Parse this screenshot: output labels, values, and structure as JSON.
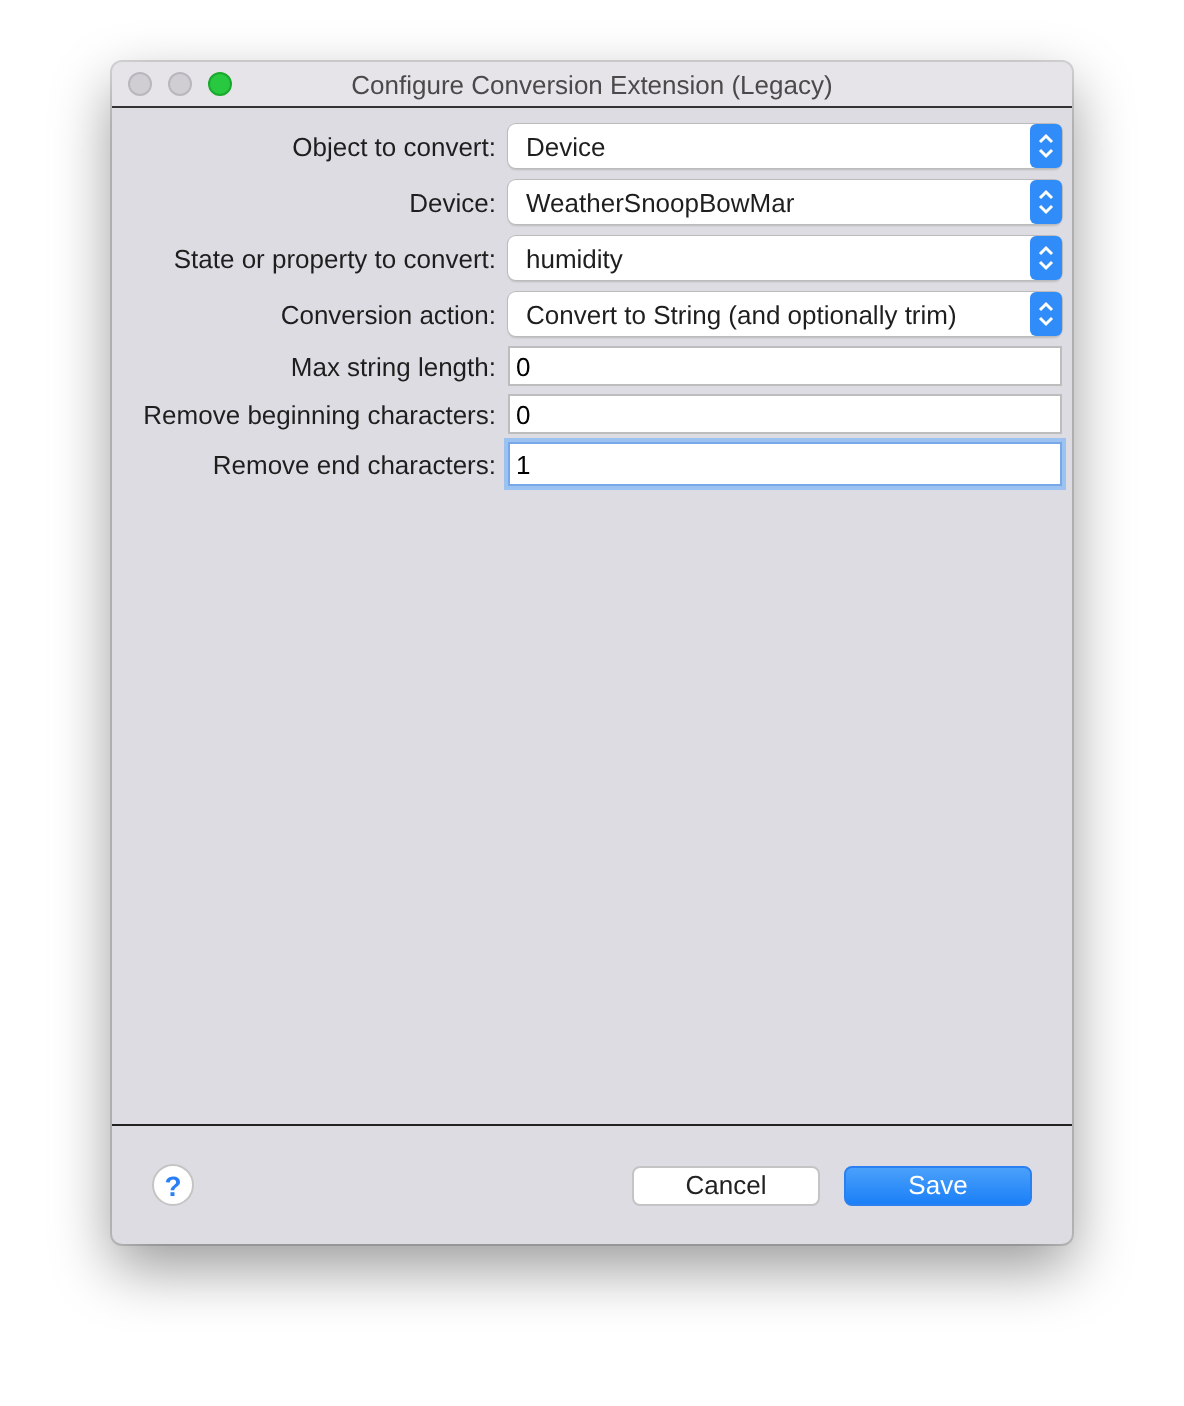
{
  "window": {
    "title": "Configure Conversion Extension (Legacy)"
  },
  "fields": [
    {
      "label": "Object to convert:",
      "kind": "popup",
      "value": "Device",
      "focused": false
    },
    {
      "label": "Device:",
      "kind": "popup",
      "value": "WeatherSnoopBowMar",
      "focused": false
    },
    {
      "label": "State or property to convert:",
      "kind": "popup",
      "value": "humidity",
      "focused": false
    },
    {
      "label": "Conversion action:",
      "kind": "popup",
      "value": "Convert to String (and optionally trim)",
      "focused": false
    },
    {
      "label": "Max string length:",
      "kind": "text",
      "value": "0",
      "focused": false
    },
    {
      "label": "Remove beginning characters:",
      "kind": "text",
      "value": "0",
      "focused": false
    },
    {
      "label": "Remove end characters:",
      "kind": "text",
      "value": "1",
      "focused": true
    }
  ],
  "footer": {
    "help": "?",
    "buttons": [
      {
        "label": "Cancel",
        "kind": "default"
      },
      {
        "label": "Save",
        "kind": "primary"
      }
    ]
  }
}
